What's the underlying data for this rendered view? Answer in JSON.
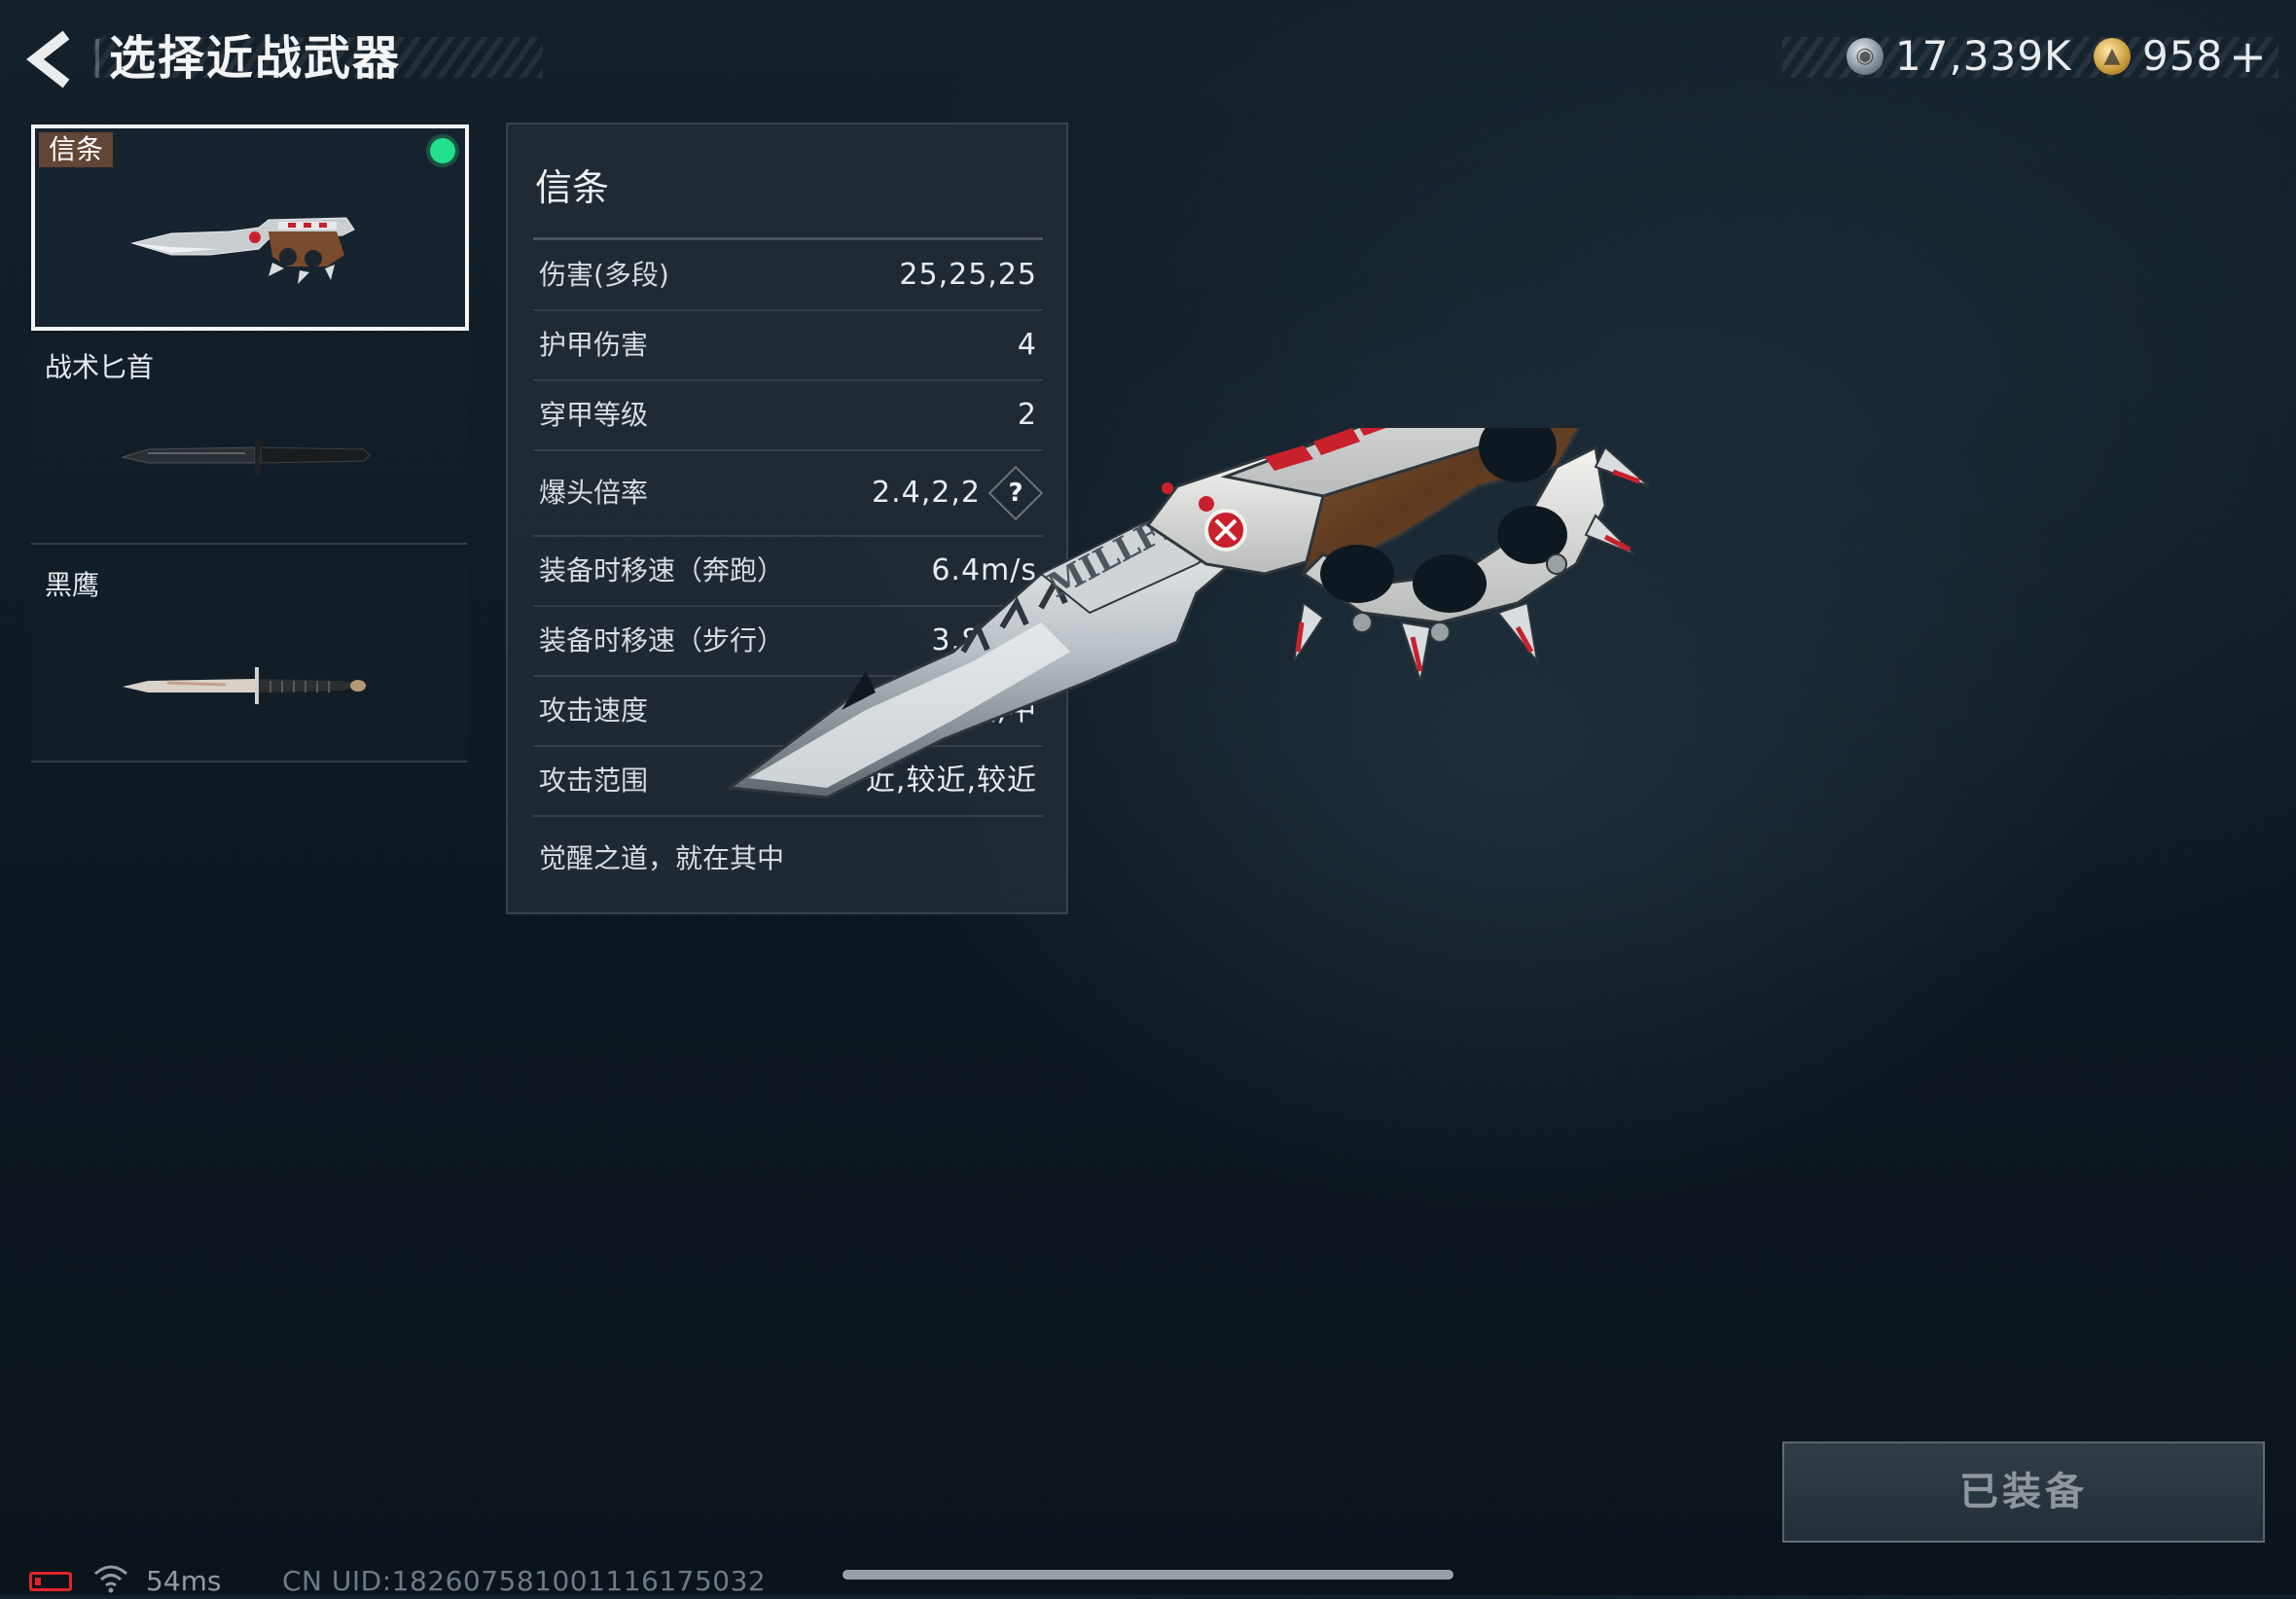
{
  "header": {
    "title": "选择近战武器",
    "currency_silver": "17,339K",
    "currency_gold": "958",
    "plus_label": "+"
  },
  "weapons": [
    {
      "name": "信条",
      "selected": true,
      "equipped": true
    },
    {
      "name": "战术匕首",
      "selected": false,
      "equipped": false
    },
    {
      "name": "黑鹰",
      "selected": false,
      "equipped": false
    }
  ],
  "stats": {
    "title": "信条",
    "rows": [
      {
        "label": "伤害(多段)",
        "value": "25,25,25"
      },
      {
        "label": "护甲伤害",
        "value": "4"
      },
      {
        "label": "穿甲等级",
        "value": "2"
      },
      {
        "label": "爆头倍率",
        "value": "2.4,2,2"
      },
      {
        "label": "装备时移速（奔跑）",
        "value": "6.4m/s"
      },
      {
        "label": "装备时移速（步行）",
        "value": "3.8m/s"
      },
      {
        "label": "攻击速度",
        "value": "快,快,中"
      },
      {
        "label": "攻击范围",
        "value": "近,较近,较近"
      }
    ],
    "help_label": "?",
    "description": "觉醒之道，就在其中"
  },
  "weapon_engraving": "MILLFIELD",
  "equip_button": {
    "label": "已装备"
  },
  "footer": {
    "ping": "54ms",
    "uid": "CN UID:182607581001116175032"
  },
  "colors": {
    "equipped_dot": "#23e08c",
    "battery": "#e0262a",
    "accent_red": "#c8202c"
  }
}
